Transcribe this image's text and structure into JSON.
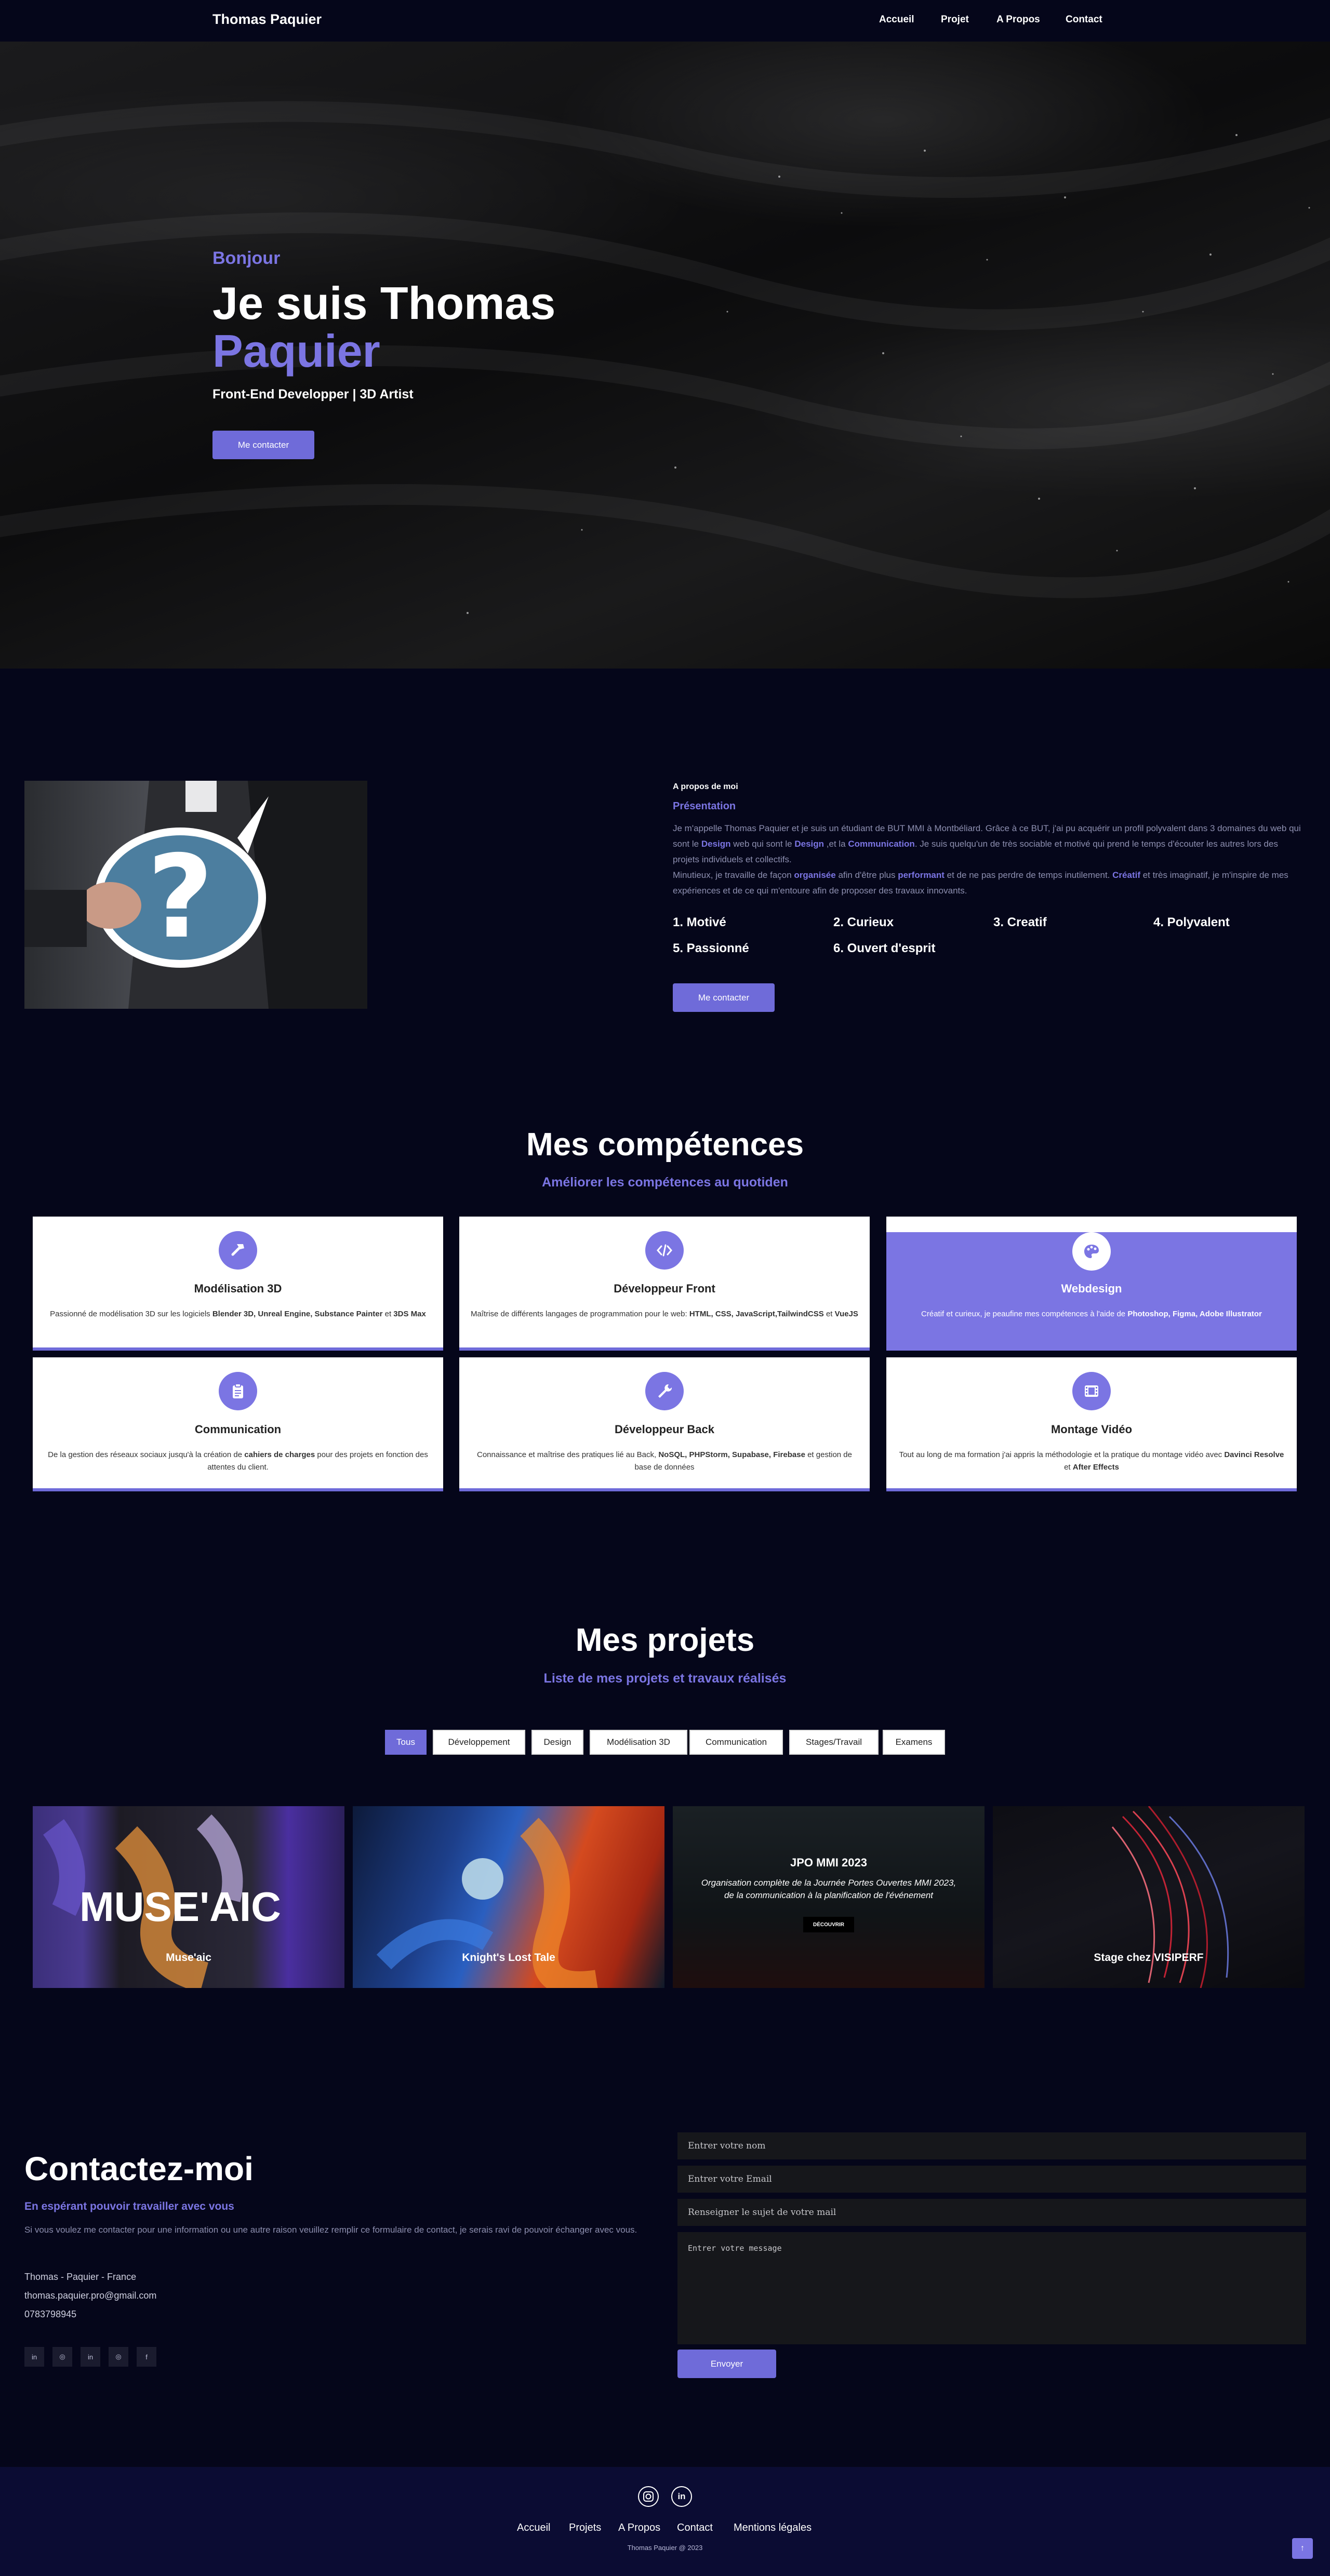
{
  "nav": {
    "brand": "Thomas Paquier",
    "links": [
      "Accueil",
      "Projet",
      "A Propos",
      "Contact"
    ]
  },
  "hero": {
    "greeting": "Bonjour",
    "title_line1": "Je suis Thomas",
    "title_line2": "Paquier",
    "subtitle": "Front-End Developper | 3D Artist",
    "cta": "Me contacter"
  },
  "about": {
    "label": "A propos de moi",
    "title": "Présentation",
    "p1_a": "Je m'appelle Thomas Paquier et je suis un étudiant de BUT MMI à Montbéliard. Grâce à ce BUT, j'ai pu acquérir un profil polyvalent dans 3 domaines du web qui sont le ",
    "p1_design": "Design",
    "p1_b": " web qui sont le ",
    "p1_design2": "Design",
    "p1_c": " ,et la ",
    "p1_comm": "Communication",
    "p1_d": ". Je suis quelqu'un de très sociable et motivé qui prend le temps d'écouter les autres lors des projets individuels et collectifs.",
    "p2_a": "Minutieux, je travaille de façon ",
    "p2_org": "organisée",
    "p2_b": " afin d'être plus ",
    "p2_perf": "performant",
    "p2_c": " et de ne pas perdre de temps inutilement. ",
    "p2_crea": "Créatif",
    "p2_d": " et très imaginatif, je m'inspire de mes expériences et de ce qui m'entoure afin de proposer des travaux innovants.",
    "traits": [
      "1. Motivé",
      "2. Curieux",
      "3. Creatif",
      "4. Polyvalent",
      "5. Passionné",
      "6. Ouvert d'esprit"
    ],
    "cta": "Me contacter"
  },
  "skills": {
    "title": "Mes compétences",
    "subtitle": "Améliorer les compétences au quotiden",
    "cards": [
      {
        "title": "Modélisation 3D",
        "icon": "hammer-icon",
        "d1": "Passionné de modélisation 3D sur les logiciels ",
        "b1": "Blender 3D, Unreal Engine, Substance Painter",
        "d2": " et ",
        "b2": "3DS Max",
        "d3": ""
      },
      {
        "title": "Développeur Front",
        "icon": "code-icon",
        "d1": "Maîtrise de différents langages de programmation pour le web: ",
        "b1": "HTML, CSS, JavaScript,TailwindCSS",
        "d2": " et ",
        "b2": "VueJS",
        "d3": ""
      },
      {
        "title": "Webdesign",
        "icon": "palette-icon",
        "d1": "Créatif et curieux, je peaufine mes compétences à l'aide de ",
        "b1": "Photoshop, Figma, Adobe Illustrator",
        "d2": "",
        "b2": "",
        "d3": ""
      },
      {
        "title": "Communication",
        "icon": "clipboard-icon",
        "d1": "De la gestion des réseaux sociaux jusqu'à la création de ",
        "b1": "cahiers de charges",
        "d2": " pour des projets en fonction des attentes du client.",
        "b2": "",
        "d3": ""
      },
      {
        "title": "Développeur Back",
        "icon": "wrench-icon",
        "d1": "Connaissance et maîtrise des pratiques lié au Back, ",
        "b1": "NoSQL, PHPStorm, Supabase, Firebase",
        "d2": " et gestion de base de données",
        "b2": "",
        "d3": ""
      },
      {
        "title": "Montage Vidéo",
        "icon": "film-icon",
        "d1": "Tout au long de ma formation j'ai appris la méthodologie et la pratique du montage vidéo avec ",
        "b1": "Davinci Resolve",
        "d2": " et ",
        "b2": "After Effects",
        "d3": ""
      }
    ]
  },
  "projects": {
    "title": "Mes projets",
    "subtitle": "Liste de mes projets et travaux réalisés",
    "filters": [
      "Tous",
      "Développement",
      "Design",
      "Modélisation 3D",
      "Communication",
      "Stages/Travail",
      "Examens"
    ],
    "items": [
      {
        "label": "Muse'aic",
        "overlay_text": "MUSE'AIC"
      },
      {
        "label": "Knight's Lost Tale"
      },
      {
        "label": "",
        "hover_title": "JPO MMI 2023",
        "hover_desc": "Organisation complète de la Journée Portes Ouvertes MMI 2023, de la communication à la planification de l'événement",
        "hover_btn": "DÉCOUVRIR"
      },
      {
        "label": "Stage chez VISIPERF"
      }
    ]
  },
  "contact": {
    "title": "Contactez-moi",
    "subtitle": "En espérant pouvoir travailler avec vous",
    "text": "Si vous voulez me contacter pour une information ou une autre raison veuillez remplir ce formulaire de contact, je serais ravi de pouvoir échanger avec vous.",
    "location": "Thomas - Paquier - France",
    "email": "thomas.paquier.pro@gmail.com",
    "phone": "0783798945",
    "socials": [
      "in",
      "◎",
      "in",
      "◎",
      "f"
    ],
    "form": {
      "name_placeholder": "Entrer votre nom",
      "email_placeholder": "Entrer votre Email",
      "subject_placeholder": "Renseigner le sujet de votre mail",
      "message_placeholder": "Entrer votre message",
      "submit": "Envoyer"
    }
  },
  "footer": {
    "links": [
      "Accueil",
      "Projets",
      "A Propos",
      "Contact",
      "Mentions légales"
    ],
    "copyright": "Thomas Paquier @ 2023",
    "to_top": "↑"
  },
  "colors": {
    "accent": "#7b75e3",
    "background": "#05061a",
    "footer": "#0b0c33"
  }
}
